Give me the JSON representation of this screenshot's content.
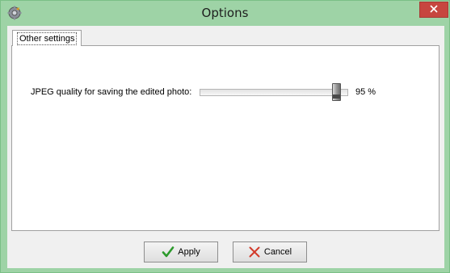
{
  "window": {
    "title": "Options",
    "close_icon": "close-icon",
    "app_icon": "gear-icon"
  },
  "tabs": [
    {
      "label": "Other settings",
      "selected": true
    }
  ],
  "settings": {
    "jpeg_label": "JPEG quality for saving the edited photo:",
    "jpeg_quality": 95,
    "jpeg_quality_text": "95 %"
  },
  "buttons": {
    "apply_label": "Apply",
    "cancel_label": "Cancel",
    "apply_icon": "checkmark-icon",
    "cancel_icon": "x-icon"
  },
  "colors": {
    "frame": "#9ed3a6",
    "close_button": "#c7463f",
    "apply_icon": "#2b9a2b",
    "cancel_icon": "#d23a2a"
  }
}
